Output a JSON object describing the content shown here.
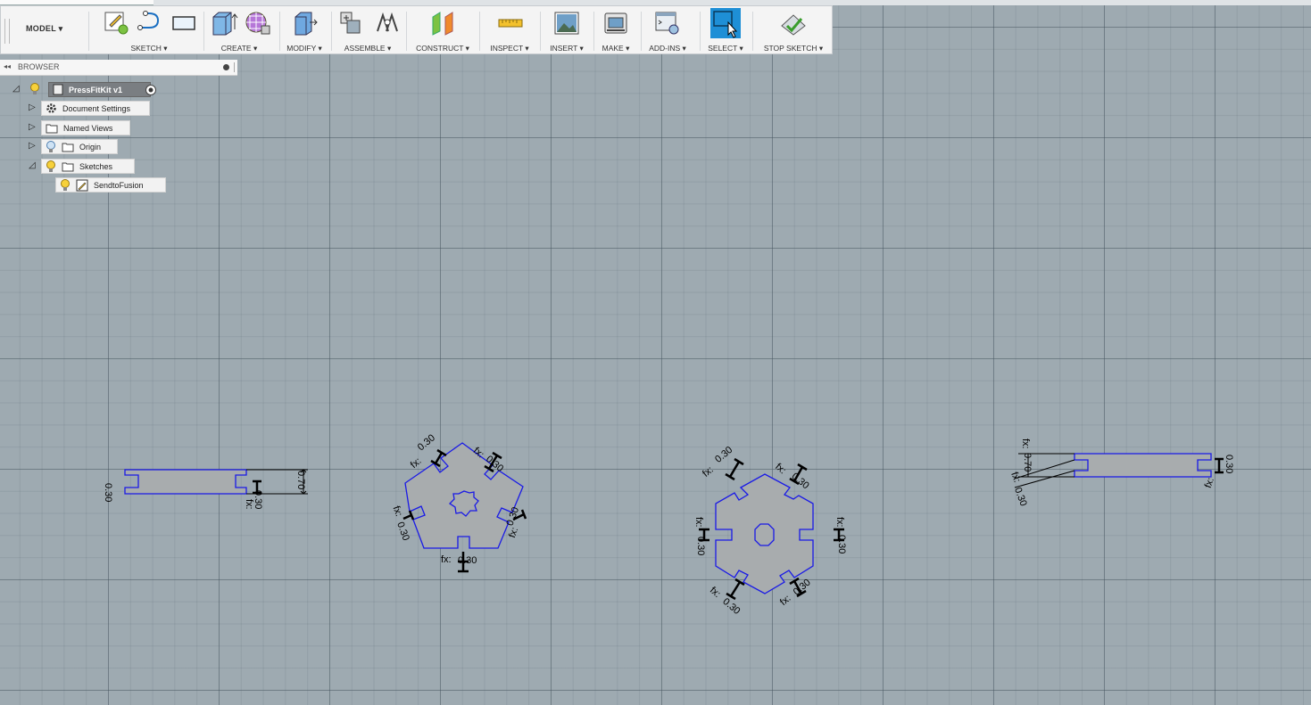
{
  "toolbar": {
    "model_label": "MODEL ▾",
    "groups": {
      "sketch": "SKETCH ▾",
      "create": "CREATE ▾",
      "modify": "MODIFY ▾",
      "assemble": "ASSEMBLE ▾",
      "construct": "CONSTRUCT ▾",
      "inspect": "INSPECT ▾",
      "insert": "INSERT ▾",
      "make": "MAKE ▾",
      "addins": "ADD-INS ▾",
      "select": "SELECT ▾",
      "stop_sketch": "STOP SKETCH ▾"
    }
  },
  "browser": {
    "title": "BROWSER",
    "root": "PressFitKit v1",
    "items": {
      "document_settings": "Document Settings",
      "named_views": "Named Views",
      "origin": "Origin",
      "sketches": "Sketches",
      "sketch1": "SendtoFusion"
    }
  },
  "dims": {
    "d030": "0.30",
    "d070": "0.70",
    "fx": "fx:"
  },
  "colors": {
    "sketch_line": "#1a1ae6",
    "profile_fill": "#a8acae",
    "selected": "#1e8fd6"
  }
}
